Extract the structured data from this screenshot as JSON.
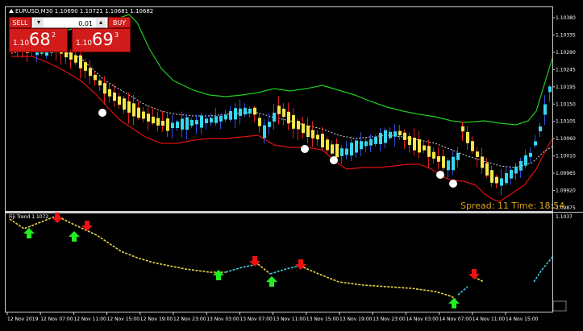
{
  "window": {
    "symbol_line": "EURUSD,M30  1.10690 1.10721 1.10681 1.10682"
  },
  "trade_panel": {
    "sell_label": "SELL",
    "buy_label": "BUY",
    "lot_value": "0.01",
    "minus_glyph": "▾",
    "plus_glyph": "▴",
    "sell_price": {
      "prefix": "1.10",
      "big": "68",
      "sup": "2"
    },
    "buy_price": {
      "prefix": "1.10",
      "big": "69",
      "sup": "3"
    }
  },
  "spread_text": "Spread: 11  Time: 18:54",
  "indicator": {
    "label": "Fiji Trend 1.1072",
    "top_value": "1.1037"
  },
  "price_axis": [
    "1.10380",
    "1.10335",
    "1.10290",
    "1.10245",
    "1.10195",
    "1.10150",
    "1.10105",
    "1.10060",
    "1.10010",
    "1.09965",
    "1.09920",
    "1.09875"
  ],
  "time_axis": [
    "12 Nov 2019",
    "12 Nov 07:00",
    "12 Nov 11:00",
    "12 Nov 15:00",
    "12 Nov 19:00",
    "12 Nov 23:00",
    "13 Nov 03:00",
    "13 Nov 07:00",
    "13 Nov 11:00",
    "13 Nov 15:00",
    "13 Nov 19:00",
    "13 Nov 23:00",
    "14 Nov 03:00",
    "14 Nov 07:00",
    "14 Nov 11:00",
    "14 Nov 15:00"
  ],
  "colors": {
    "bull": "#37d6ee",
    "bear": "#f5e64b",
    "upper_band": "#22cc22",
    "lower_band": "#e01010",
    "mid_line": "#dcdcdc",
    "arrow_up": "#22ee22",
    "arrow_down": "#ee1111",
    "grid": "#ffffff",
    "spread": "#d8a51a"
  },
  "icons": {
    "arrow_up": "green-up-arrow-icon",
    "arrow_down": "red-down-arrow-icon",
    "signal_dot": "white-dot-icon"
  }
}
